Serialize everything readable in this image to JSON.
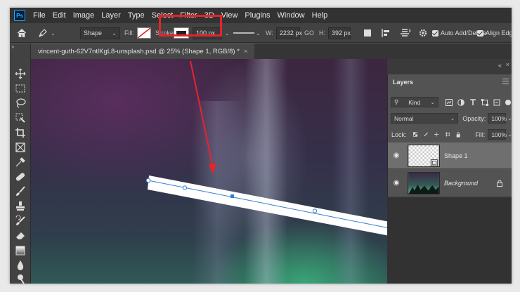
{
  "app": {
    "logo": "Ps",
    "menu": [
      "File",
      "Edit",
      "Image",
      "Layer",
      "Type",
      "Select",
      "Filter",
      "3D",
      "View",
      "Plugins",
      "Window",
      "Help"
    ]
  },
  "options": {
    "tool_mode": "Shape",
    "fill_label": "Fill:",
    "stroke_label": "Stroke:",
    "stroke_width": "100 px",
    "w_label": "W:",
    "w_value": "2232 px",
    "link_icon": "GO",
    "h_label": "H:",
    "h_value": "392 px",
    "auto_add_delete": "Auto Add/Delete",
    "align_edges": "Align Edges"
  },
  "document": {
    "tab_title": "vincent-guth-62V7ntlKgL8-unsplash.psd @ 25% (Shape 1, RGB/8) *",
    "close_glyph": "×"
  },
  "layers_panel": {
    "tab_label": "Layers",
    "filter_kind": "Kind",
    "blend_mode": "Normal",
    "opacity_label": "Opacity:",
    "opacity_value": "100%",
    "lock_label": "Lock:",
    "fill_label": "Fill:",
    "fill_value": "100%",
    "layers": [
      {
        "name": "Shape 1",
        "selected": true
      },
      {
        "name": "Background",
        "selected": false,
        "locked": true
      }
    ]
  },
  "colors": {
    "highlight": "#e8232a",
    "path": "#2f7fd1",
    "panel": "#535353"
  },
  "icons": [
    "home-icon",
    "pen-tool-icon",
    "move-icon",
    "marquee-icon",
    "lasso-icon",
    "quick-select-icon",
    "crop-icon",
    "frame-icon",
    "eyedropper-icon",
    "healing-icon",
    "brush-icon",
    "stamp-icon",
    "history-brush-icon",
    "eraser-icon",
    "gradient-icon",
    "blur-icon",
    "dodge-icon",
    "eye-icon",
    "lock-icon",
    "gear-icon"
  ]
}
